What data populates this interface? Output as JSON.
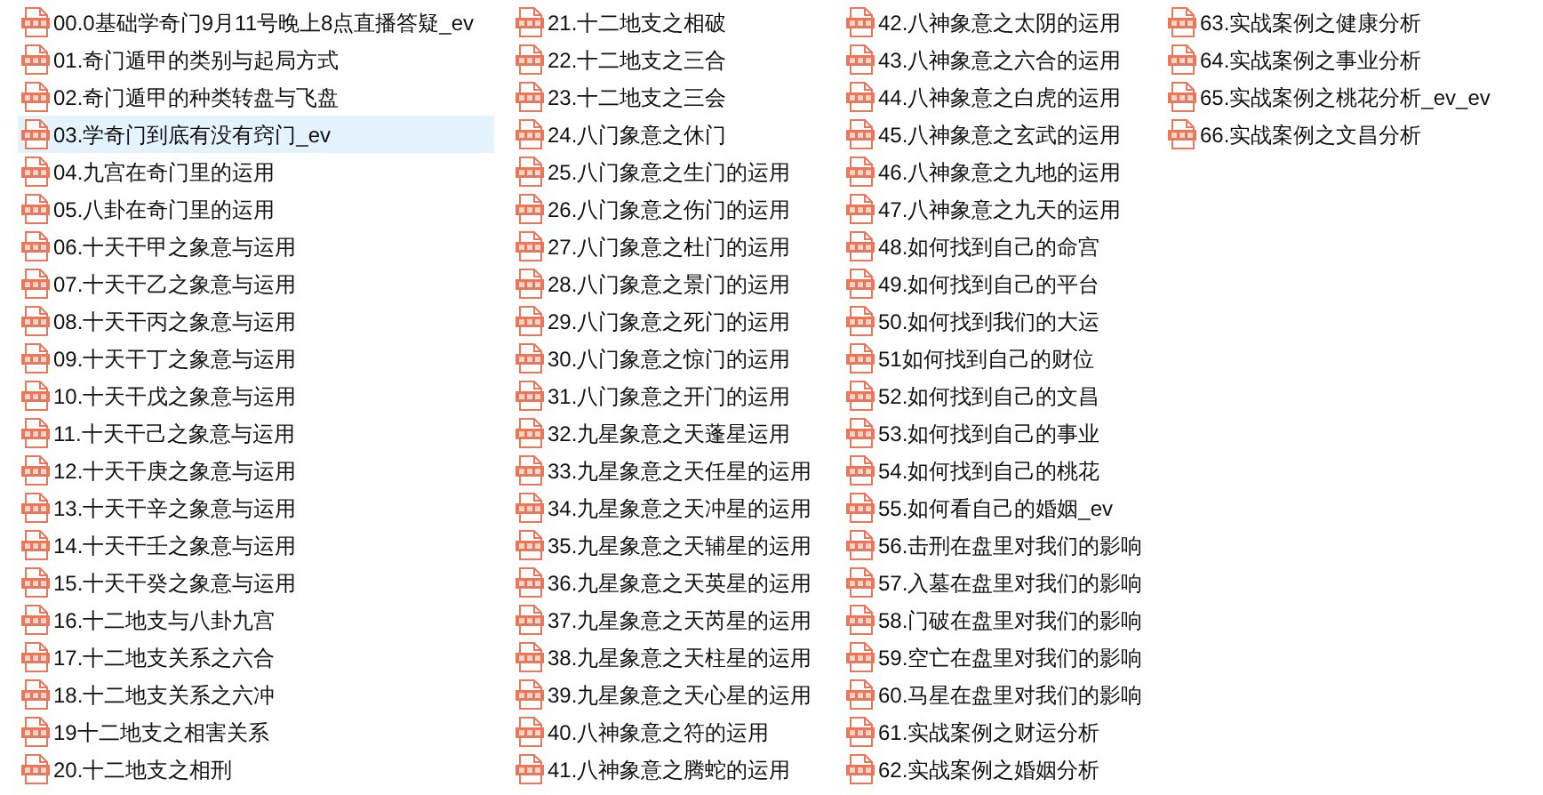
{
  "files": [
    {
      "name": "00.0基础学奇门9月11号晚上8点直播答疑_ev",
      "selected": false
    },
    {
      "name": "01.奇门遁甲的类别与起局方式",
      "selected": false
    },
    {
      "name": "02.奇门遁甲的种类转盘与飞盘",
      "selected": false
    },
    {
      "name": "03.学奇门到底有没有窍门_ev",
      "selected": true
    },
    {
      "name": "04.九宫在奇门里的运用",
      "selected": false
    },
    {
      "name": "05.八卦在奇门里的运用",
      "selected": false
    },
    {
      "name": "06.十天干甲之象意与运用",
      "selected": false
    },
    {
      "name": "07.十天干乙之象意与运用",
      "selected": false
    },
    {
      "name": "08.十天干丙之象意与运用",
      "selected": false
    },
    {
      "name": "09.十天干丁之象意与运用",
      "selected": false
    },
    {
      "name": "10.十天干戊之象意与运用",
      "selected": false
    },
    {
      "name": "11.十天干己之象意与运用",
      "selected": false
    },
    {
      "name": "12.十天干庚之象意与运用",
      "selected": false
    },
    {
      "name": "13.十天干辛之象意与运用",
      "selected": false
    },
    {
      "name": "14.十天干壬之象意与运用",
      "selected": false
    },
    {
      "name": "15.十天干癸之象意与运用",
      "selected": false
    },
    {
      "name": "16.十二地支与八卦九宫",
      "selected": false
    },
    {
      "name": "17.十二地支关系之六合",
      "selected": false
    },
    {
      "name": "18.十二地支关系之六冲",
      "selected": false
    },
    {
      "name": "19十二地支之相害关系",
      "selected": false
    },
    {
      "name": "20.十二地支之相刑",
      "selected": false
    },
    {
      "name": "21.十二地支之相破",
      "selected": false
    },
    {
      "name": "22.十二地支之三合",
      "selected": false
    },
    {
      "name": "23.十二地支之三会",
      "selected": false
    },
    {
      "name": "24.八门象意之休门",
      "selected": false
    },
    {
      "name": "25.八门象意之生门的运用",
      "selected": false
    },
    {
      "name": "26.八门象意之伤门的运用",
      "selected": false
    },
    {
      "name": "27.八门象意之杜门的运用",
      "selected": false
    },
    {
      "name": "28.八门象意之景门的运用",
      "selected": false
    },
    {
      "name": "29.八门象意之死门的运用",
      "selected": false
    },
    {
      "name": "30.八门象意之惊门的运用",
      "selected": false
    },
    {
      "name": "31.八门象意之开门的运用",
      "selected": false
    },
    {
      "name": "32.九星象意之天蓬星运用",
      "selected": false
    },
    {
      "name": "33.九星象意之天任星的运用",
      "selected": false
    },
    {
      "name": "34.九星象意之天冲星的运用",
      "selected": false
    },
    {
      "name": "35.九星象意之天辅星的运用",
      "selected": false
    },
    {
      "name": "36.九星象意之天英星的运用",
      "selected": false
    },
    {
      "name": "37.九星象意之天芮星的运用",
      "selected": false
    },
    {
      "name": "38.九星象意之天柱星的运用",
      "selected": false
    },
    {
      "name": "39.九星象意之天心星的运用",
      "selected": false
    },
    {
      "name": "40.八神象意之符的运用",
      "selected": false
    },
    {
      "name": "41.八神象意之腾蛇的运用",
      "selected": false
    },
    {
      "name": "42.八神象意之太阴的运用",
      "selected": false
    },
    {
      "name": "43.八神象意之六合的运用",
      "selected": false
    },
    {
      "name": "44.八神象意之白虎的运用",
      "selected": false
    },
    {
      "name": "45.八神象意之玄武的运用",
      "selected": false
    },
    {
      "name": "46.八神象意之九地的运用",
      "selected": false
    },
    {
      "name": "47.八神象意之九天的运用",
      "selected": false
    },
    {
      "name": "48.如何找到自己的命宫",
      "selected": false
    },
    {
      "name": "49.如何找到自己的平台",
      "selected": false
    },
    {
      "name": "50.如何找到我们的大运",
      "selected": false
    },
    {
      "name": "51如何找到自己的财位",
      "selected": false
    },
    {
      "name": "52.如何找到自己的文昌",
      "selected": false
    },
    {
      "name": "53.如何找到自己的事业",
      "selected": false
    },
    {
      "name": "54.如何找到自己的桃花",
      "selected": false
    },
    {
      "name": "55.如何看自己的婚姻_ev",
      "selected": false
    },
    {
      "name": "56.击刑在盘里对我们的影响",
      "selected": false
    },
    {
      "name": "57.入墓在盘里对我们的影响",
      "selected": false
    },
    {
      "name": "58.门破在盘里对我们的影响",
      "selected": false
    },
    {
      "name": "59.空亡在盘里对我们的影响",
      "selected": false
    },
    {
      "name": "60.马星在盘里对我们的影响",
      "selected": false
    },
    {
      "name": "61.实战案例之财运分析",
      "selected": false
    },
    {
      "name": "62.实战案例之婚姻分析",
      "selected": false
    },
    {
      "name": "63.实战案例之健康分析",
      "selected": false
    },
    {
      "name": "64.实战案例之事业分析",
      "selected": false
    },
    {
      "name": "65.实战案例之桃花分析_ev_ev",
      "selected": false
    },
    {
      "name": "66.实战案例之文昌分析",
      "selected": false
    }
  ]
}
